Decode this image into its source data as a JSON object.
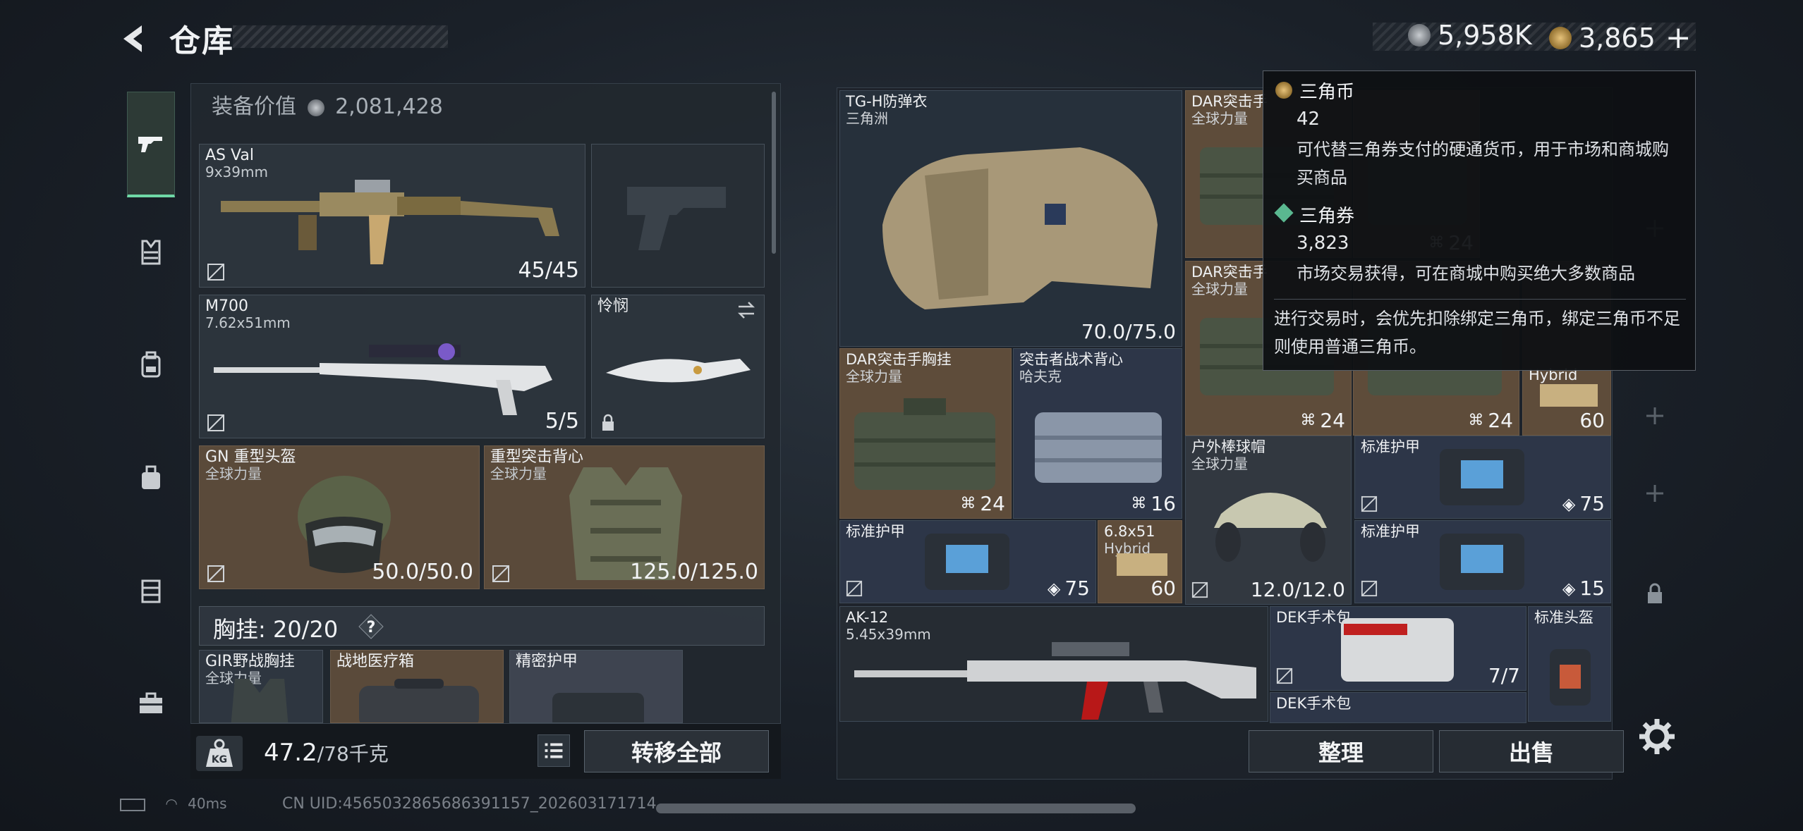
{
  "header": {
    "title": "仓库",
    "currency1": "5,958K",
    "currency2": "3,865",
    "plus": "+"
  },
  "left_panel": {
    "equip_value_label": "装备价值",
    "equip_value": "2,081,428",
    "slots": [
      {
        "name": "AS Val",
        "sub": "9x39mm",
        "value": "45/45"
      },
      {
        "name": "M700",
        "sub": "7.62x51mm",
        "value": "5/5"
      },
      {
        "name": "怜悯",
        "sub": "",
        "value": ""
      },
      {
        "name": "GN 重型头盔",
        "sub": "全球力量",
        "value": "50.0/50.0"
      },
      {
        "name": "重型突击背心",
        "sub": "全球力量",
        "value": "125.0/125.0"
      }
    ],
    "chest_rig_label": "胸挂: 20/20",
    "chest_items": [
      {
        "name": "GIR野战胸挂",
        "sub": "全球力量"
      },
      {
        "name": "战地医疗箱",
        "sub": ""
      },
      {
        "name": "精密护甲",
        "sub": ""
      }
    ],
    "weight": "47.2",
    "weight_max": "/78千克",
    "transfer_all": "转移全部"
  },
  "right_panel": {
    "items": [
      {
        "name": "TG-H防弹衣",
        "sub": "三角洲",
        "value": "70.0/75.0"
      },
      {
        "name": "DAR突击手",
        "sub": "全球力量",
        "value": ""
      },
      {
        "name": "DAR突击手胸挂",
        "sub": "全球力量",
        "value": "24"
      },
      {
        "name": "DAR突击手胸挂",
        "sub": "全球力量",
        "value": "24"
      },
      {
        "name": "突击者战术背心",
        "sub": "哈夫克",
        "value": "16"
      },
      {
        "name": "DAR突击手",
        "sub": "全球力量",
        "value": "24"
      },
      {
        "name": "",
        "sub": "",
        "value": "24"
      },
      {
        "name": "Hybrid",
        "sub": "",
        "value": "60"
      },
      {
        "name": "户外棒球帽",
        "sub": "全球力量",
        "value": "12.0/12.0"
      },
      {
        "name": "标准护甲",
        "sub": "",
        "value": "75"
      },
      {
        "name": "标准护甲",
        "sub": "",
        "value": "75"
      },
      {
        "name": "6.8x51",
        "sub": "Hybrid",
        "value": "60"
      },
      {
        "name": "标准护甲",
        "sub": "",
        "value": "15"
      },
      {
        "name": "AK-12",
        "sub": "5.45x39mm",
        "value": ""
      },
      {
        "name": "DEK手术包",
        "sub": "",
        "value": "7/7"
      },
      {
        "name": "标准头盔",
        "sub": "",
        "value": ""
      },
      {
        "name": "DEK手术包",
        "sub": "",
        "value": ""
      }
    ],
    "sort": "整理",
    "sell": "出售"
  },
  "tooltip": {
    "coin_title": "三角币",
    "coin_value": "42",
    "coin_desc": "可代替三角券支付的硬通货币，用于市场和商城购买商品",
    "ticket_title": "三角券",
    "ticket_value": "3,823",
    "ticket_desc": "市场交易获得，可在商城中购买绝大多数商品",
    "note": "进行交易时，会优先扣除绑定三角币，绑定三角币不足则使用普通三角币。"
  },
  "status": {
    "ping": "40ms",
    "uid": "CN UID:4565032865686391157_202603171714"
  },
  "colors": {
    "accent": "#6fd8a6",
    "slot_brown": "#5a4a3a",
    "slot_blue": "#2d3648"
  }
}
